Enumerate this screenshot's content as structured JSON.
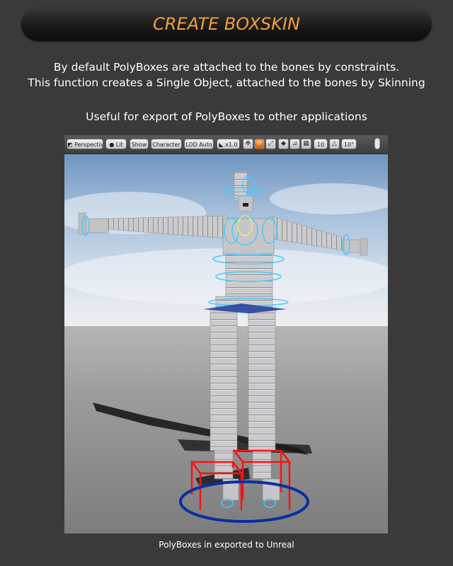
{
  "header": {
    "title": "CREATE BOXSKIN"
  },
  "description": {
    "line1": "By default PolyBoxes are attached to the bones by constraints.",
    "line2": "This function creates a Single Object, attached to the bones by Skinning",
    "line3": "Useful for export of PolyBoxes to other applications"
  },
  "viewport": {
    "toolbar": {
      "perspective_label": "Perspective",
      "lit_label": "Lit",
      "show_label": "Show",
      "character_label": "Character",
      "lod_label": "LOD Auto",
      "speed_label": "x1.0",
      "grid_size_label": "10",
      "angle_snap_label": "10°"
    },
    "icons": [
      "perspective-view-icon",
      "lit-sphere-icon",
      "camera-speed-icon",
      "translate-icon",
      "rotate-icon",
      "scale-icon",
      "coordinate-space-icon",
      "surface-snap-icon",
      "grid-snap-icon",
      "rotation-snap-icon"
    ],
    "colors": {
      "sky": "#c6d6e6",
      "ground": "#8a8a8a",
      "character": "#c9c9cb",
      "bone_helper": "#49c8ff",
      "constraint_box": "#ff1010",
      "ground_circle": "#0a2ea0",
      "active_tool": "#f59a3a"
    }
  },
  "caption": "PolyBoxes in exported to Unreal"
}
